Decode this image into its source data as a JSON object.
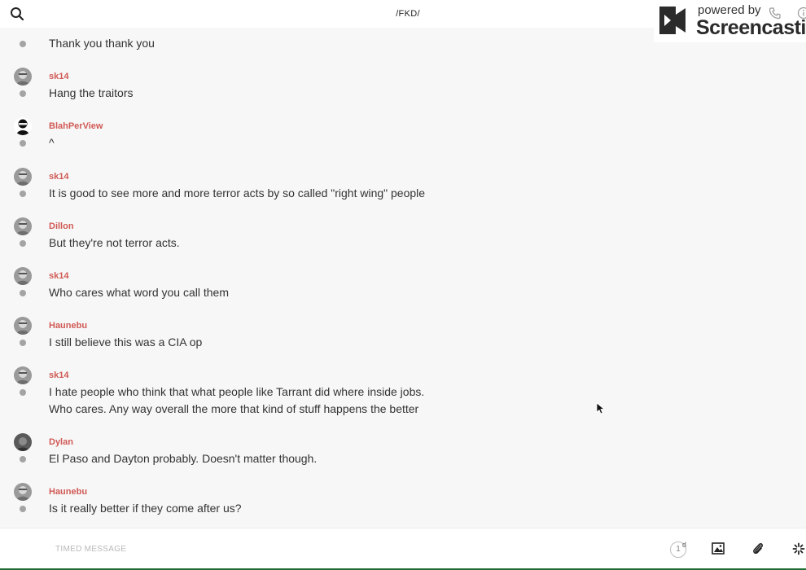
{
  "header": {
    "title": "/FKD/"
  },
  "watermark": {
    "powered": "powered by",
    "brand": "Screencastify"
  },
  "messages": [
    {
      "author": "",
      "lines": [
        "Thank you thank you"
      ],
      "avatar": null
    },
    {
      "author": "sk14",
      "lines": [
        "Hang the traitors"
      ],
      "avatar": "gray-face"
    },
    {
      "author": "BlahPerView",
      "lines": [
        "^"
      ],
      "avatar": "dark-face"
    },
    {
      "author": "sk14",
      "lines": [
        "It is good to see more and more terror acts by so called \"right wing\" people"
      ],
      "avatar": "gray-face"
    },
    {
      "author": "Dillon",
      "lines": [
        "But they're not terror acts."
      ],
      "avatar": "gray-face"
    },
    {
      "author": "sk14",
      "lines": [
        "Who cares what word you call them"
      ],
      "avatar": "gray-face"
    },
    {
      "author": "Haunebu",
      "lines": [
        "I still believe this was a CIA op"
      ],
      "avatar": "gray-face"
    },
    {
      "author": "sk14",
      "lines": [
        "I hate people who think that what people like Tarrant did where inside jobs.",
        "Who cares. Any way overall the more that kind of stuff happens the better"
      ],
      "avatar": "gray-face"
    },
    {
      "author": "Dylan",
      "lines": [
        "El Paso and Dayton probably. Doesn't matter though."
      ],
      "avatar": "dark-gray"
    },
    {
      "author": "Haunebu",
      "lines": [
        "Is it really better if they come after us?"
      ],
      "avatar": "gray-face"
    }
  ],
  "composer": {
    "placeholder": "TIMED MESSAGE",
    "timer_value": "1",
    "timer_unit": "d"
  },
  "colors": {
    "author": "#d05a55",
    "dot": "#a4a4a4",
    "background": "#f7f7f7"
  }
}
